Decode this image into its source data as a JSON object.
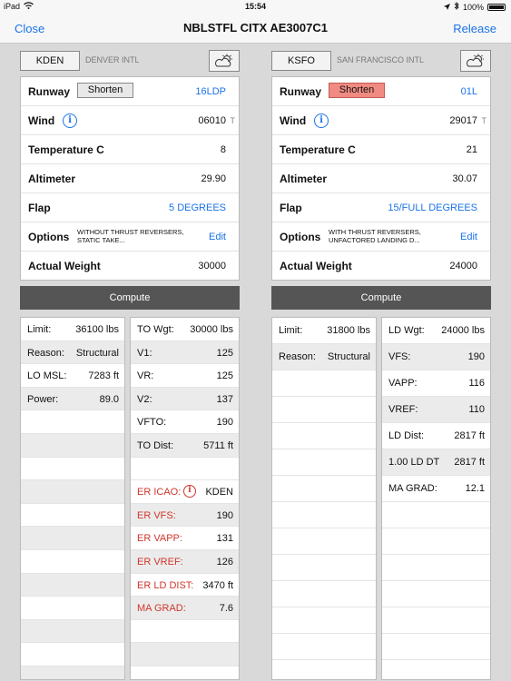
{
  "status": {
    "device": "iPad",
    "time": "15:54",
    "battery": "100%"
  },
  "nav": {
    "close": "Close",
    "title": "NBLSTFL CITX AE3007C1",
    "release": "Release"
  },
  "departure": {
    "icao": "KDEN",
    "name": "DENVER INTL",
    "runway_label": "Runway",
    "shorten": "Shorten",
    "runway": "16LDP",
    "wind_label": "Wind",
    "wind": "06010",
    "wind_unit": "T",
    "temp_label": "Temperature C",
    "temp": "8",
    "alt_label": "Altimeter",
    "alt": "29.90",
    "flap_label": "Flap",
    "flap": "5 DEGREES",
    "options_label": "Options",
    "options": "WITHOUT THRUST REVERSERS, STATIC TAKE...",
    "edit": "Edit",
    "weight_label": "Actual Weight",
    "weight": "30000",
    "compute": "Compute",
    "limits": [
      {
        "k": "Limit:",
        "v": "36100 lbs"
      },
      {
        "k": "Reason:",
        "v": "Structural"
      },
      {
        "k": "LO MSL:",
        "v": "7283 ft"
      },
      {
        "k": "Power:",
        "v": "89.0"
      }
    ],
    "perf": [
      {
        "k": "TO Wgt:",
        "v": "30000 lbs"
      },
      {
        "k": "V1:",
        "v": "125"
      },
      {
        "k": "VR:",
        "v": "125"
      },
      {
        "k": "V2:",
        "v": "137"
      },
      {
        "k": "VFTO:",
        "v": "190"
      },
      {
        "k": "TO Dist:",
        "v": "5711 ft"
      }
    ],
    "er": [
      {
        "k": "ER ICAO:",
        "v": "KDEN"
      },
      {
        "k": "ER VFS:",
        "v": "190"
      },
      {
        "k": "ER VAPP:",
        "v": "131"
      },
      {
        "k": "ER VREF:",
        "v": "126"
      },
      {
        "k": "ER LD DIST:",
        "v": "3470 ft"
      },
      {
        "k": "MA GRAD:",
        "v": "7.6"
      }
    ]
  },
  "arrival": {
    "icao": "KSFO",
    "name": "SAN FRANCISCO INTL",
    "runway_label": "Runway",
    "shorten": "Shorten",
    "runway": "01L",
    "wind_label": "Wind",
    "wind": "29017",
    "wind_unit": "T",
    "temp_label": "Temperature C",
    "temp": "21",
    "alt_label": "Altimeter",
    "alt": "30.07",
    "flap_label": "Flap",
    "flap": "15/FULL DEGREES",
    "options_label": "Options",
    "options": "WITH THRUST REVERSERS, UNFACTORED LANDING D...",
    "edit": "Edit",
    "weight_label": "Actual Weight",
    "weight": "24000",
    "compute": "Compute",
    "limits": [
      {
        "k": "Limit:",
        "v": "31800 lbs"
      },
      {
        "k": "Reason:",
        "v": "Structural"
      }
    ],
    "perf": [
      {
        "k": "LD Wgt:",
        "v": "24000 lbs"
      },
      {
        "k": "VFS:",
        "v": "190"
      },
      {
        "k": "VAPP:",
        "v": "116"
      },
      {
        "k": "VREF:",
        "v": "110"
      },
      {
        "k": "LD Dist:",
        "v": "2817 ft"
      },
      {
        "k": "1.00 LD DT",
        "v": "2817 ft"
      },
      {
        "k": "MA GRAD:",
        "v": "12.1"
      }
    ]
  }
}
